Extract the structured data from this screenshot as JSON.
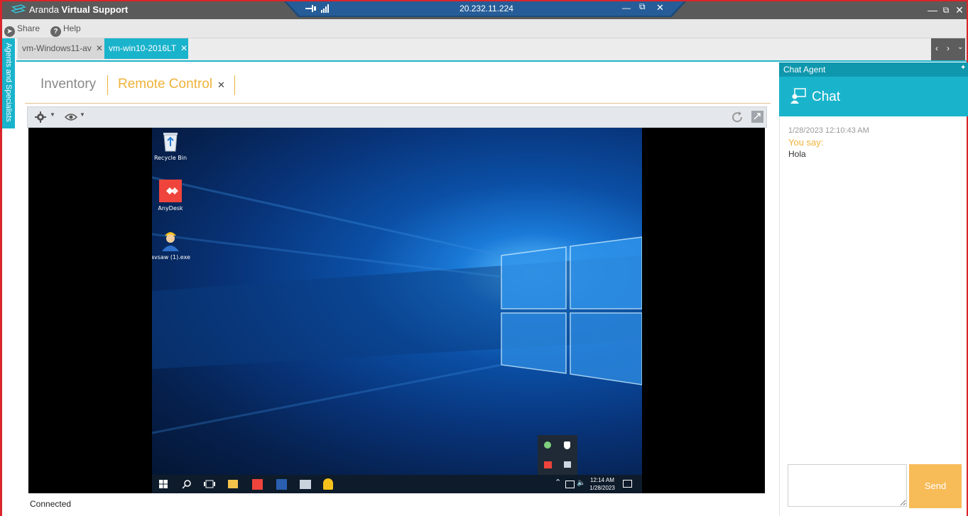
{
  "window": {
    "title_prefix": "Aranda",
    "title_bold": "Virtual Support",
    "remote_address": "20.232.11.224"
  },
  "toolbar": {
    "share_label": "Share",
    "help_label": "Help"
  },
  "tabs": [
    {
      "label": "vm-Windows11-av",
      "active": false
    },
    {
      "label": "vm-win10-2016LT",
      "active": true
    }
  ],
  "side_tab": {
    "label": "Agents and Specialists"
  },
  "modules": {
    "inventory_label": "Inventory",
    "remote_control_label": "Remote Control"
  },
  "desktop": {
    "icons": [
      {
        "label": "Recycle Bin",
        "icon": "recycle-bin-icon"
      },
      {
        "label": "AnyDesk",
        "icon": "anydesk-icon"
      },
      {
        "label": "avsaw (1).exe",
        "icon": "avsaw-user-icon"
      }
    ],
    "clock_time": "12:14 AM",
    "clock_date": "1/28/2023"
  },
  "status": {
    "text": "Connected"
  },
  "chat": {
    "header": "Chat Agent",
    "title": "Chat",
    "messages": [
      {
        "time": "1/28/2023 12:10:43 AM",
        "who": "You say:",
        "text": "Hola"
      }
    ],
    "send_label": "Send",
    "input_value": ""
  },
  "colors": {
    "accent": "#1ab3cc",
    "frame": "#d9252b",
    "highlight": "#f0b23a",
    "send": "#f7bb58"
  }
}
